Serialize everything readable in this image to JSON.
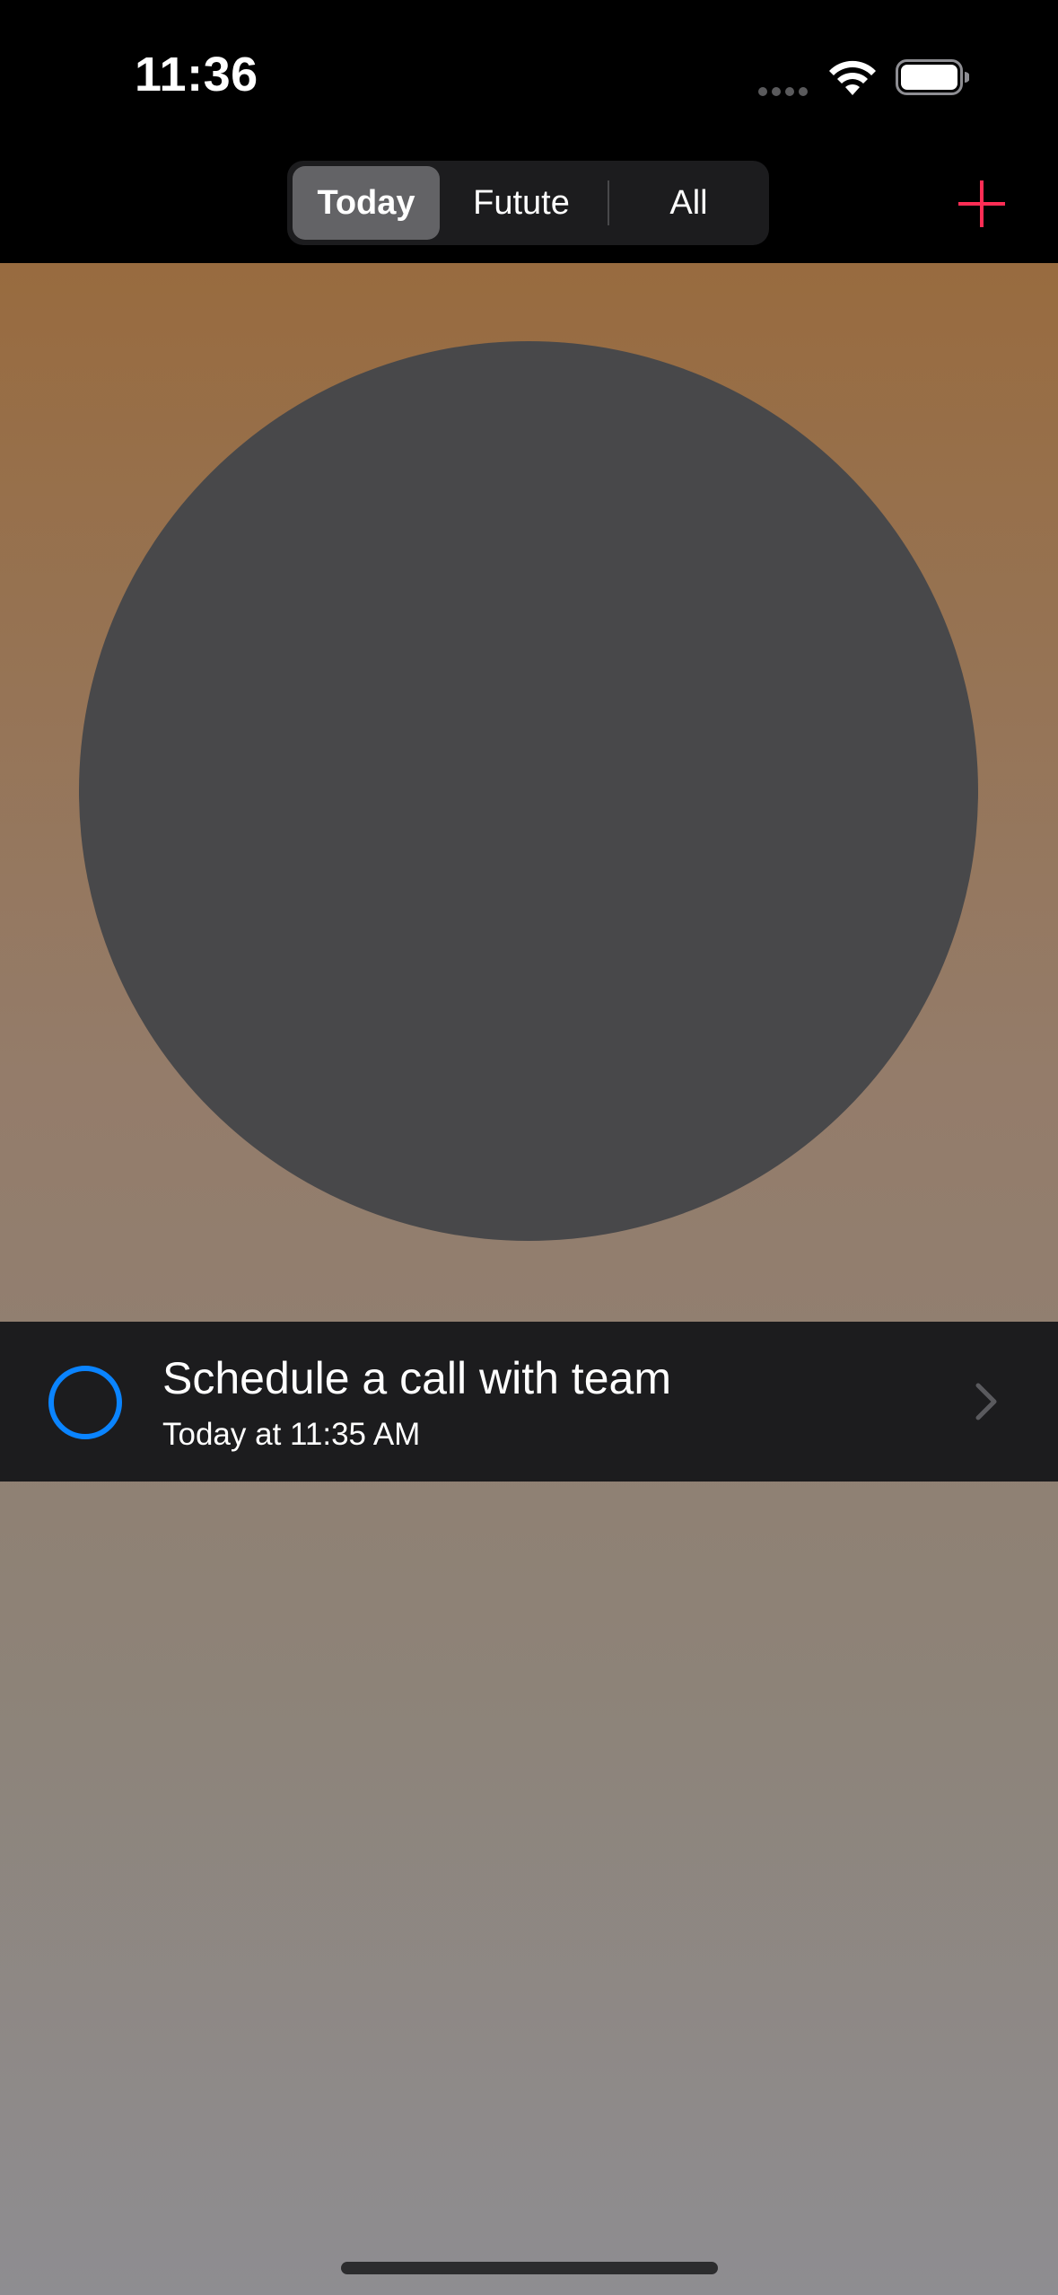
{
  "status_bar": {
    "time": "11:36"
  },
  "nav": {
    "segments": [
      {
        "label": "Today",
        "selected": true
      },
      {
        "label": "Futute",
        "selected": false
      },
      {
        "label": "All",
        "selected": false
      }
    ],
    "add_icon": "plus-icon"
  },
  "colors": {
    "accent_add": "#ff2d55",
    "check_ring": "#0a84ff",
    "circle": "#48484a",
    "row_background": "#1c1c1e"
  },
  "task": {
    "title": "Schedule a call with team",
    "subtitle": "Today at 11:35 AM",
    "completed": false,
    "disclosure_icon": "chevron-right-icon"
  }
}
